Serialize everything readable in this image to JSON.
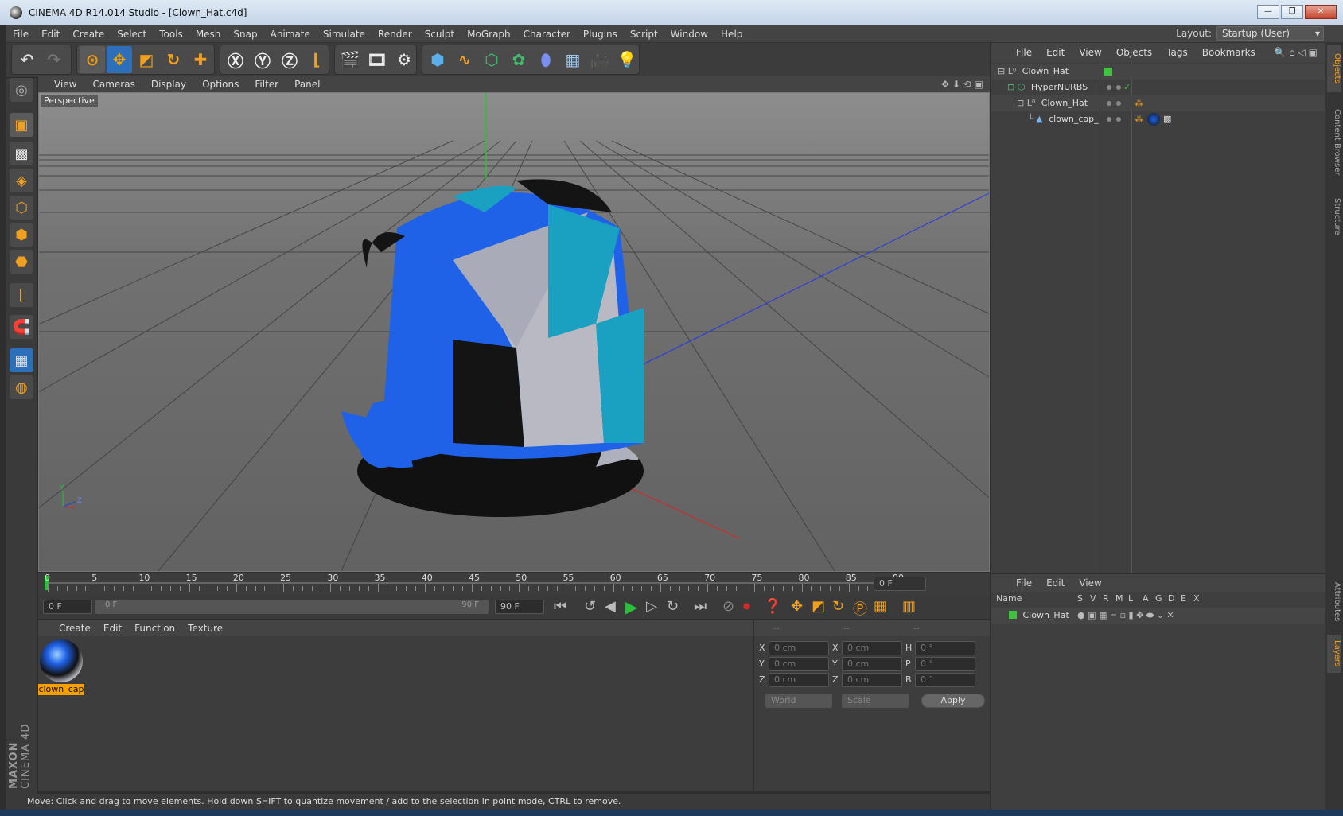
{
  "window": {
    "title": "CINEMA 4D R14.014 Studio - [Clown_Hat.c4d]",
    "min": "—",
    "max": "❐",
    "close": "✕"
  },
  "menu": [
    "File",
    "Edit",
    "Create",
    "Select",
    "Tools",
    "Mesh",
    "Snap",
    "Animate",
    "Simulate",
    "Render",
    "Sculpt",
    "MoGraph",
    "Character",
    "Plugins",
    "Script",
    "Window",
    "Help"
  ],
  "layout": {
    "label": "Layout:",
    "value": "Startup (User)"
  },
  "viewport": {
    "menu": [
      "View",
      "Cameras",
      "Display",
      "Options",
      "Filter",
      "Panel"
    ],
    "label": "Perspective",
    "axis_y": "Y",
    "axis_z": "Z"
  },
  "timeline": {
    "ticks": [
      "0",
      "5",
      "10",
      "15",
      "20",
      "25",
      "30",
      "35",
      "40",
      "45",
      "50",
      "55",
      "60",
      "65",
      "70",
      "75",
      "80",
      "85",
      "90"
    ],
    "current": "0 F",
    "start": "0 F",
    "range_start": "0 F",
    "range_end": "90 F",
    "end": "90 F"
  },
  "materials": {
    "menu": [
      "Create",
      "Edit",
      "Function",
      "Texture"
    ],
    "items": [
      {
        "name": "clown_cap"
      }
    ]
  },
  "coords": {
    "headers": [
      "--",
      "--",
      "--"
    ],
    "rows": [
      {
        "a": "X",
        "av": "0 cm",
        "b": "X",
        "bv": "0 cm",
        "c": "H",
        "cv": "0 °"
      },
      {
        "a": "Y",
        "av": "0 cm",
        "b": "Y",
        "bv": "0 cm",
        "c": "P",
        "cv": "0 °"
      },
      {
        "a": "Z",
        "av": "0 cm",
        "b": "Z",
        "bv": "0 cm",
        "c": "B",
        "cv": "0 °"
      }
    ],
    "space": "World",
    "mode": "Scale",
    "apply": "Apply"
  },
  "objects": {
    "menu": [
      "File",
      "Edit",
      "View",
      "Objects",
      "Tags",
      "Bookmarks"
    ],
    "tree": [
      {
        "name": "Clown_Hat",
        "icon": "null-icon"
      },
      {
        "name": "HyperNURBS",
        "icon": "hypernurbs-icon",
        "check": "✓"
      },
      {
        "name": "Clown_Hat",
        "icon": "null-icon"
      },
      {
        "name": "clown_cap_",
        "icon": "polygon-icon"
      }
    ]
  },
  "layers": {
    "menu": [
      "File",
      "Edit",
      "View"
    ],
    "columns": [
      "Name",
      "S",
      "V",
      "R",
      "M",
      "L",
      "A",
      "G",
      "D",
      "E",
      "X"
    ],
    "rows": [
      {
        "name": "Clown_Hat",
        "color": "#3fc23f"
      }
    ]
  },
  "right_tabs": [
    "Objects",
    "Content Browser",
    "Structure",
    "Attributes",
    "Layers"
  ],
  "maxon": {
    "brand": "MAXON",
    "product": "CINEMA 4D"
  },
  "status": "Move: Click and drag to move elements. Hold down SHIFT to quantize movement / add to the selection in point mode, CTRL to remove.",
  "colors": {
    "accent": "#f0a020",
    "selection": "#f5a000",
    "layer_green": "#3fc23f",
    "hat_blue": "#1f62e8",
    "hat_teal": "#1aa0c0",
    "hat_white": "#b9b9c4",
    "hat_black": "#111111"
  }
}
